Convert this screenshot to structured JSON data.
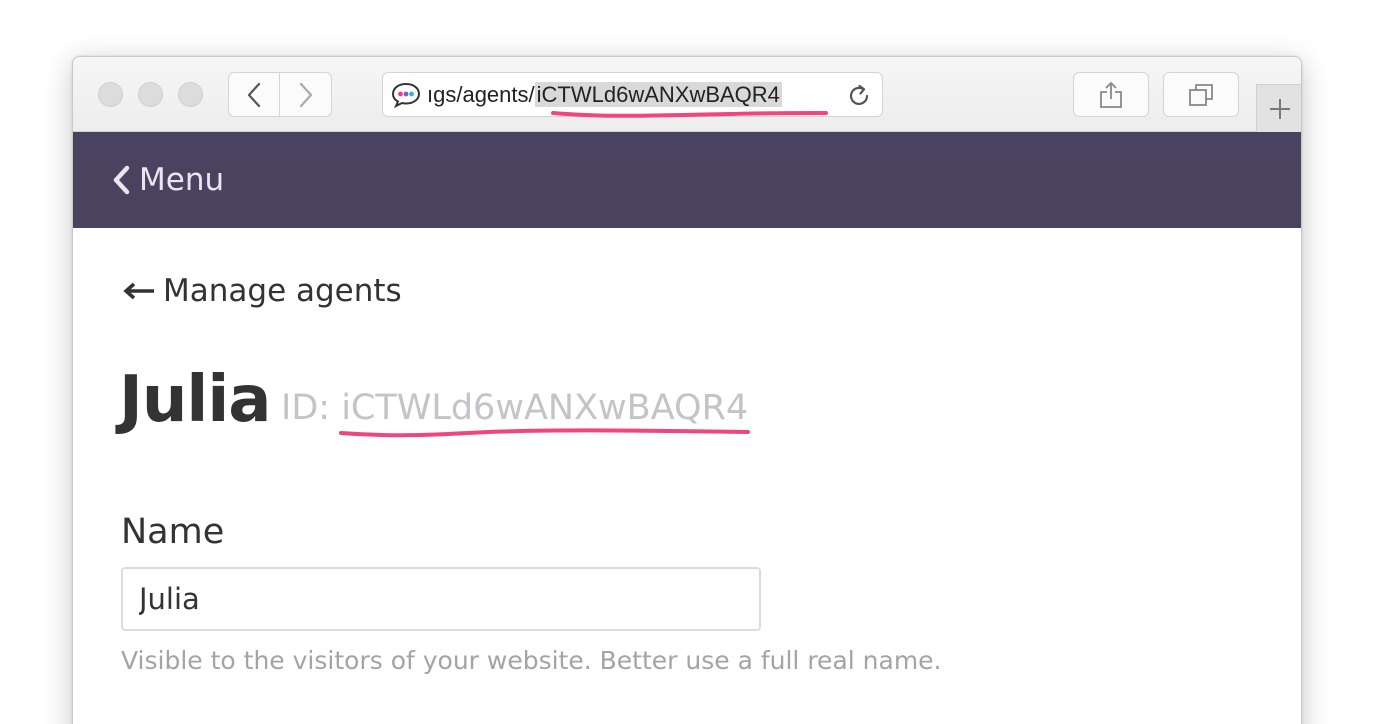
{
  "browser": {
    "url_prefix": "ıgs/agents/",
    "url_selected": "iCTWLd6wANXwBAQR4",
    "favicon_icon": "chat-bubble-icon",
    "back_icon": "chevron-left-icon",
    "forward_icon": "chevron-right-icon",
    "reload_icon": "reload-icon",
    "share_icon": "share-icon",
    "tabs_icon": "tabs-overview-icon",
    "newtab_icon": "plus-icon"
  },
  "header": {
    "menu_label": "Menu",
    "background": "#4a4360"
  },
  "content": {
    "back_link": "Manage agents",
    "agent_name": "Julia",
    "agent_id": "ID: iCTWLd6wANXwBAQR4",
    "form": {
      "name_label": "Name",
      "name_value": "Julia",
      "name_help": "Visible to the visitors of your website. Better use a full real name."
    }
  },
  "annotation_color": "#f0457e"
}
